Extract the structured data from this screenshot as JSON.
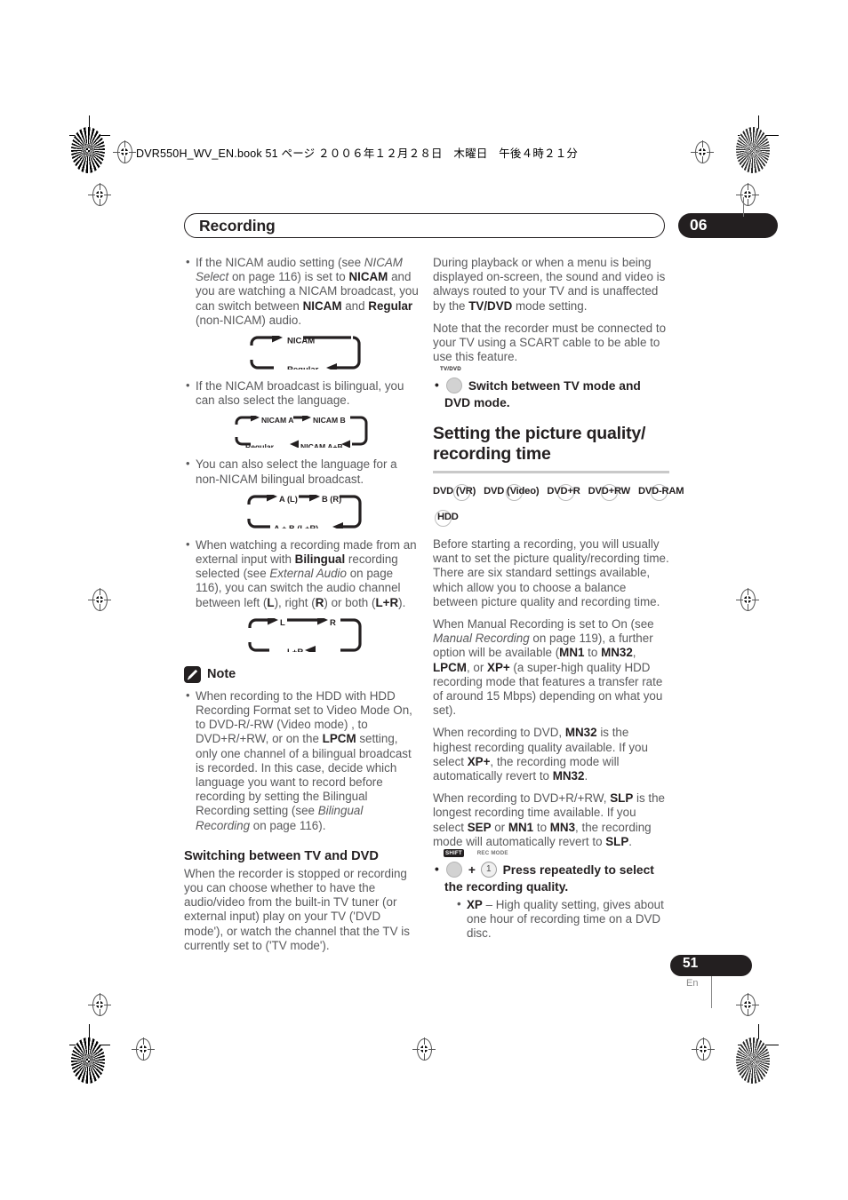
{
  "book_header": "DVR550H_WV_EN.book  51 ページ  ２００６年１２月２８日　木曜日　午後４時２１分",
  "chapter": {
    "title": "Recording",
    "number": "06"
  },
  "footer": {
    "page_number": "51",
    "language": "En"
  },
  "left_column": {
    "bullets": [
      {
        "id": "nicam-audio-setting",
        "segments": [
          {
            "t": "If the NICAM audio setting (see ",
            "s": "normal"
          },
          {
            "t": "NICAM Select",
            "s": "italic"
          },
          {
            "t": " on page 116) is set to ",
            "s": "normal"
          },
          {
            "t": "NICAM",
            "s": "bold"
          },
          {
            "t": " and you are watching a NICAM broadcast, you can switch between ",
            "s": "normal"
          },
          {
            "t": "NICAM",
            "s": "bold"
          },
          {
            "t": " and ",
            "s": "normal"
          },
          {
            "t": "Regular",
            "s": "bold"
          },
          {
            "t": " (non-NICAM) audio.",
            "s": "normal"
          }
        ]
      },
      {
        "id": "nicam-bilingual",
        "segments": [
          {
            "t": "If the NICAM broadcast is bilingual, you can also select the language.",
            "s": "normal"
          }
        ]
      },
      {
        "id": "non-nicam-bilingual",
        "segments": [
          {
            "t": "You can also select the language for a non-NICAM bilingual broadcast.",
            "s": "normal"
          }
        ]
      },
      {
        "id": "external-input-bilingual",
        "segments": [
          {
            "t": "When watching a recording made from an external input with ",
            "s": "normal"
          },
          {
            "t": "Bilingual",
            "s": "bold"
          },
          {
            "t": " recording selected (see ",
            "s": "normal"
          },
          {
            "t": "External Audio",
            "s": "italic"
          },
          {
            "t": " on page 116), you can switch the audio channel between left (",
            "s": "normal"
          },
          {
            "t": "L",
            "s": "bold"
          },
          {
            "t": "), right (",
            "s": "normal"
          },
          {
            "t": "R",
            "s": "bold"
          },
          {
            "t": ") or both (",
            "s": "normal"
          },
          {
            "t": "L+R",
            "s": "bold"
          },
          {
            "t": ").",
            "s": "normal"
          }
        ]
      }
    ],
    "cycles": [
      {
        "id": "cycle-nicam-regular",
        "top": [
          "NICAM"
        ],
        "bottom": [
          "Regular"
        ]
      },
      {
        "id": "cycle-nicam-ab",
        "top": [
          "NICAM A",
          "NICAM B"
        ],
        "bottom": [
          "NICAM A+B",
          "Regular"
        ]
      },
      {
        "id": "cycle-ab-lr",
        "top": [
          "A (L)",
          "B (R)"
        ],
        "bottom": [
          "A + B (L+R)"
        ]
      },
      {
        "id": "cycle-l-r",
        "top": [
          "L",
          "R"
        ],
        "bottom": [
          "L+R"
        ]
      }
    ],
    "note": {
      "label": "Note",
      "items": [
        {
          "id": "note-hdd-bilingual",
          "segments": [
            {
              "t": "When recording to the HDD with HDD Recording Format set to Video Mode On, to DVD-R/-RW (Video mode) , to DVD+R/+RW, or on the ",
              "s": "normal"
            },
            {
              "t": "LPCM",
              "s": "bold"
            },
            {
              "t": " setting, only one channel of a bilingual broadcast is recorded. In this case, decide which language you want to record before recording by setting the Bilingual Recording setting (see ",
              "s": "normal"
            },
            {
              "t": "Bilingual Recording",
              "s": "italic"
            },
            {
              "t": " on page 116).",
              "s": "normal"
            }
          ]
        }
      ]
    },
    "subsection": {
      "heading": "Switching between TV and DVD",
      "body": "When the recorder is stopped or recording you can choose whether to have the audio/video from the built-in TV tuner (or external input) play on your TV ('DVD mode'), or watch the channel that the TV is currently set to ('TV mode')."
    }
  },
  "right_column": {
    "intro_paragraphs": [
      {
        "id": "playback-routing",
        "segments": [
          {
            "t": "During playback or when a menu is being displayed on-screen, the sound and video is always routed to your TV and is unaffected by the ",
            "s": "normal"
          },
          {
            "t": "TV/DVD",
            "s": "bold"
          },
          {
            "t": " mode setting.",
            "s": "normal"
          }
        ]
      },
      {
        "id": "scart-requirement",
        "segments": [
          {
            "t": "Note that the recorder must be connected to your TV using a SCART cable to be able to use this feature.",
            "s": "normal"
          }
        ]
      }
    ],
    "tvdvd_key": {
      "label": "TV/DVD",
      "instruction": "Switch between TV mode and DVD mode."
    },
    "section": {
      "heading": "Setting the picture quality/ recording time"
    },
    "format_badges": [
      {
        "id": "badge-dvd-vr",
        "label": "DVD (VR)"
      },
      {
        "id": "badge-dvd-video",
        "label": "DVD (Video)"
      },
      {
        "id": "badge-dvd-plus-r",
        "label": "DVD+R"
      },
      {
        "id": "badge-dvd-plus-rw",
        "label": "DVD+RW"
      },
      {
        "id": "badge-dvd-ram",
        "label": "DVD-RAM"
      },
      {
        "id": "badge-hdd",
        "label": "HDD"
      }
    ],
    "paragraphs": [
      {
        "id": "before-recording",
        "segments": [
          {
            "t": "Before starting a recording, you will usually want to set the picture quality/recording time. There are six standard settings available, which allow you to choose a balance between picture quality and recording time.",
            "s": "normal"
          }
        ]
      },
      {
        "id": "manual-recording",
        "segments": [
          {
            "t": "When Manual Recording is set to On (see ",
            "s": "normal"
          },
          {
            "t": "Manual Recording",
            "s": "italic"
          },
          {
            "t": " on page 119), a further option will be available (",
            "s": "normal"
          },
          {
            "t": "MN1",
            "s": "bold"
          },
          {
            "t": " to ",
            "s": "normal"
          },
          {
            "t": "MN32",
            "s": "bold"
          },
          {
            "t": ", ",
            "s": "normal"
          },
          {
            "t": "LPCM",
            "s": "bold"
          },
          {
            "t": ", or ",
            "s": "normal"
          },
          {
            "t": "XP+",
            "s": "bold"
          },
          {
            "t": " (a super-high quality HDD recording mode that features a transfer rate of around 15 Mbps) depending on what you set).",
            "s": "normal"
          }
        ]
      },
      {
        "id": "dvd-mn32",
        "segments": [
          {
            "t": "When recording to DVD, ",
            "s": "normal"
          },
          {
            "t": "MN32",
            "s": "bold"
          },
          {
            "t": " is the highest recording quality available. If you select ",
            "s": "normal"
          },
          {
            "t": "XP+",
            "s": "bold"
          },
          {
            "t": ", the recording mode will automatically revert to ",
            "s": "normal"
          },
          {
            "t": "MN32",
            "s": "bold"
          },
          {
            "t": ".",
            "s": "normal"
          }
        ]
      },
      {
        "id": "dvdplus-slp",
        "segments": [
          {
            "t": "When recording to DVD+R/+RW, ",
            "s": "normal"
          },
          {
            "t": "SLP",
            "s": "bold"
          },
          {
            "t": " is the longest recording time available. If you select ",
            "s": "normal"
          },
          {
            "t": "SEP",
            "s": "bold"
          },
          {
            "t": " or ",
            "s": "normal"
          },
          {
            "t": "MN1",
            "s": "bold"
          },
          {
            "t": " to ",
            "s": "normal"
          },
          {
            "t": "MN3",
            "s": "bold"
          },
          {
            "t": ", the recording mode will automatically revert to ",
            "s": "normal"
          },
          {
            "t": "SLP",
            "s": "bold"
          },
          {
            "t": ".",
            "s": "normal"
          }
        ]
      }
    ],
    "rec_mode_key": {
      "shift_label": "SHIFT",
      "rec_mode_label": "REC MODE",
      "rec_mode_number": "1",
      "plus": "+",
      "instruction": "Press repeatedly to select the recording quality.",
      "sub_items": [
        {
          "id": "xp-mode",
          "segments": [
            {
              "t": "XP",
              "s": "bold"
            },
            {
              "t": " – High quality setting, gives about one hour of recording time on a DVD disc.",
              "s": "normal"
            }
          ]
        }
      ]
    }
  }
}
